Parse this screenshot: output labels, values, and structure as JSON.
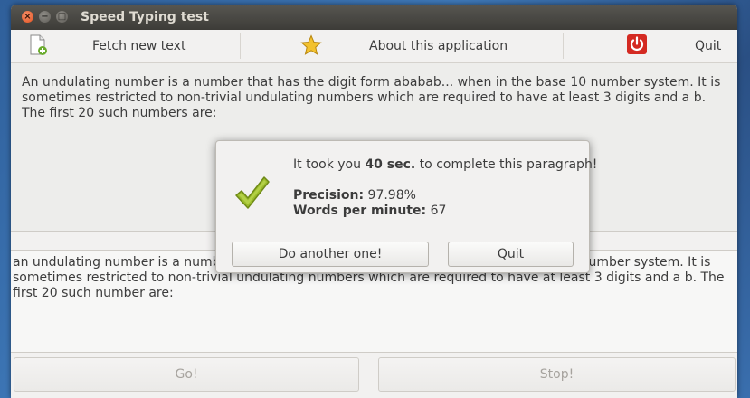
{
  "window": {
    "title": "Speed Typing test"
  },
  "toolbar": {
    "fetch_label": "Fetch new text",
    "about_label": "About this application",
    "quit_label": "Quit"
  },
  "source_text": "An undulating number is a number that has the digit form ababab... when in the base 10 number system. It is sometimes restricted to non-trivial undulating numbers which are required to have at least 3 digits and a  b. The first 20 such numbers are:",
  "typed_text": "an undulating number is a number that has the digit form ababab... when in the base 10 number system. It is sometimes restricted to non-trivial undulating numbers which are required to have at least 3 digits and a b. The first 20 such number are:",
  "dialog": {
    "time_prefix": "It took you ",
    "time_value": "40 sec.",
    "time_suffix": " to complete this paragraph!",
    "precision_label": "Precision:",
    "precision_value": "97.98%",
    "wpm_label": "Words per minute:",
    "wpm_value": "67",
    "again_button": "Do another one!",
    "quit_button": "Quit"
  },
  "controls": {
    "go_button": "Go!",
    "stop_button": "Stop!"
  },
  "icons": {
    "fetch": "new-document-icon",
    "about": "star-icon",
    "quit": "power-icon",
    "success": "checkmark-icon"
  },
  "colors": {
    "titlebar": "#3d3c38",
    "close_button": "#e2511f",
    "power_icon": "#d42a22",
    "star_icon": "#f2c12e",
    "checkmark": "#9cbc2b"
  }
}
